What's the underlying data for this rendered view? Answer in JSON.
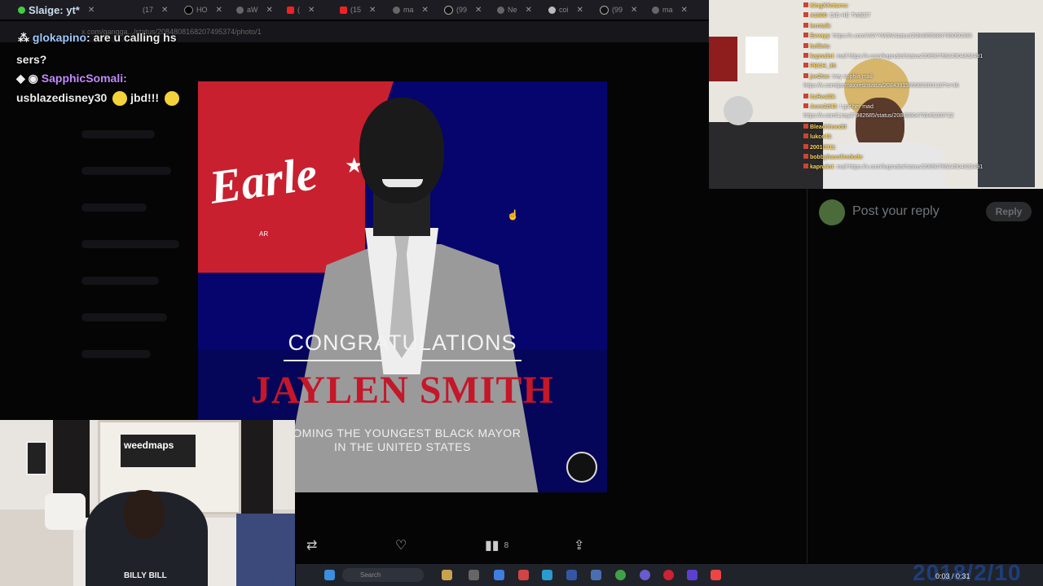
{
  "tabs": [
    {
      "label": "Slaige: yt*",
      "x": 0
    },
    {
      "label": "(17",
      "x": 0
    },
    {
      "label": "HO",
      "x": 0
    },
    {
      "label": "aW",
      "x": 0
    },
    {
      "label": "(",
      "x": 0
    },
    {
      "label": "(15",
      "x": 0
    },
    {
      "label": "ma",
      "x": 0
    },
    {
      "label": "(99",
      "x": 0
    },
    {
      "label": "Ne",
      "x": 0
    },
    {
      "label": "coi",
      "x": 0
    },
    {
      "label": "(99",
      "x": 0
    },
    {
      "label": "ma",
      "x": 0
    }
  ],
  "url": "x.com/gangga.../status/2084808168207495374/photo/1",
  "chat_overlay": {
    "line1_user": "glokapino",
    "line1_text": "are u calling hs",
    "line2_text": "sers?",
    "line3_user": "SapphicSomali:",
    "line4_text": "usblazedisney30",
    "line4_tail": "jbd!!!"
  },
  "photo": {
    "city": "Earle",
    "city_sub": "AR",
    "headline": "CONGRATULATIONS",
    "name": "JAYLEN SMITH",
    "subline_1": "COMING THE YOUNGEST BLACK MAYOR",
    "subline_2": "IN THE UNITED STATES"
  },
  "actions": {
    "views": "8"
  },
  "cam1": {
    "banner": "weedmaps",
    "shirt": "BILLY BILL"
  },
  "right_chat": [
    {
      "user": "KingXXntares",
      "msg": ""
    },
    {
      "user": "A1600",
      "msg": "DID HE TWEET"
    },
    {
      "user": "lerntalk",
      "msg": ""
    },
    {
      "user": "Evvayy",
      "msg": "https://x.com/VAYYM3N/status/2084855983785050383"
    },
    {
      "user": "hellieis",
      "msg": ""
    },
    {
      "user": "kapnalot",
      "msg": "mail https://x.com/kapnalot/status/2085078624504332491"
    },
    {
      "user": "PBCH_35",
      "msg": ""
    },
    {
      "user": "jae2tac",
      "msg": "trey sophia mail"
    },
    {
      "user": "",
      "msg": "https://x.com/jaemaxxed/status/2084391589980283110?s=46"
    },
    {
      "user": "itsReal2k",
      "msg": ""
    },
    {
      "user": "Aces3d43",
      "msg": "I got her mad"
    },
    {
      "user": "",
      "msg": "https://x.com/Liray27982685/status/2084886476945260722"
    },
    {
      "user": "Bleachhoodd",
      "msg": ""
    },
    {
      "user": "lukce43",
      "msg": ""
    },
    {
      "user": "20010911",
      "msg": ""
    },
    {
      "user": "bobbybasolimdude",
      "msg": ""
    },
    {
      "user": "kapnalot",
      "msg": "mail https://x.com/kapnalot/status/2085078624504332491"
    }
  ],
  "reply": {
    "placeholder": "Post your reply",
    "button": "Reply"
  },
  "taskbar": {
    "search": "Search"
  },
  "overlay_clock": "2018/2/10",
  "video_time": "0:03 / 0:31"
}
